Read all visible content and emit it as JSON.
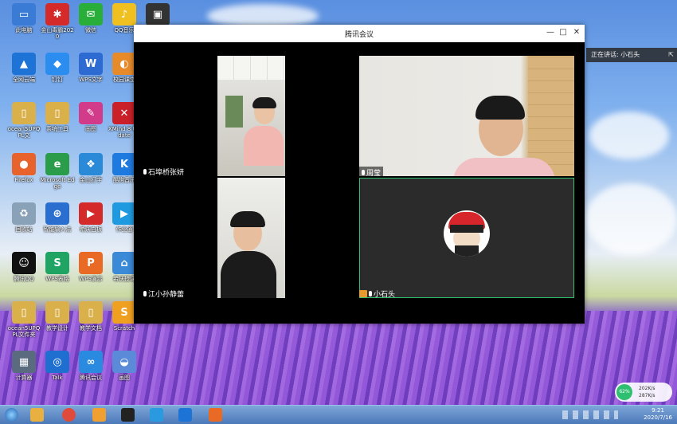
{
  "desktop": {
    "icons": [
      {
        "label": "此电脑",
        "color": "#3a7bd5",
        "glyph": "▭"
      },
      {
        "label": "全网云端",
        "color": "#1d74d6",
        "glyph": "▲"
      },
      {
        "label": "ocean5UPQPL文",
        "color": "#d9b04a",
        "glyph": "▯"
      },
      {
        "label": "Firefox",
        "color": "#e8632b",
        "glyph": "●"
      },
      {
        "label": "回收站",
        "color": "#8aa2b8",
        "glyph": "♻"
      },
      {
        "label": "腾讯QQ",
        "color": "#111111",
        "glyph": "☺"
      },
      {
        "label": "ocean5UPQPL文件夹",
        "color": "#d9b04a",
        "glyph": "▯"
      },
      {
        "label": "计算器",
        "color": "#5a6b80",
        "glyph": "▦"
      },
      {
        "label": "金山毒霸2020",
        "color": "#d42a2a",
        "glyph": "✱"
      },
      {
        "label": "钉钉",
        "color": "#2c8df0",
        "glyph": "◆"
      },
      {
        "label": "系统工具",
        "color": "#d9b04a",
        "glyph": "▯"
      },
      {
        "label": "Microsoft Edge",
        "color": "#2a9c4a",
        "glyph": "e"
      },
      {
        "label": "智能输入法",
        "color": "#2a6fd0",
        "glyph": "⊕"
      },
      {
        "label": "WPS表格",
        "color": "#1fa463",
        "glyph": "S"
      },
      {
        "label": "教学设计",
        "color": "#d9b04a",
        "glyph": "▯"
      },
      {
        "label": "Talk",
        "color": "#1f6fd1",
        "glyph": "◎"
      },
      {
        "label": "微信",
        "color": "#2aae3a",
        "glyph": "✉"
      },
      {
        "label": "WPS文字",
        "color": "#2d6ad2",
        "glyph": "W"
      },
      {
        "label": "画图",
        "color": "#d23a8a",
        "glyph": "✎"
      },
      {
        "label": "金山打字",
        "color": "#2a8ad8",
        "glyph": "❖"
      },
      {
        "label": "希沃白板",
        "color": "#d42a2a",
        "glyph": "▶"
      },
      {
        "label": "WPS演示",
        "color": "#e96a24",
        "glyph": "P"
      },
      {
        "label": "教学文档",
        "color": "#d9b04a",
        "glyph": "▯"
      },
      {
        "label": "腾讯会议",
        "color": "#2a8ae0",
        "glyph": "∞"
      },
      {
        "label": "QQ音乐",
        "color": "#f0c020",
        "glyph": "♪"
      },
      {
        "label": "校园课堂",
        "color": "#e78a2a",
        "glyph": "◐"
      },
      {
        "label": "XMind 8 Update",
        "color": "#c9202a",
        "glyph": "✕"
      },
      {
        "label": "酷狗音乐",
        "color": "#1f7ae0",
        "glyph": "K"
      },
      {
        "label": "作业通",
        "color": "#1f9ae0",
        "glyph": "▶"
      },
      {
        "label": "希沃授课",
        "color": "#3a8ad8",
        "glyph": "⌂"
      },
      {
        "label": "Scratch",
        "color": "#f0a020",
        "glyph": "S"
      },
      {
        "label": "画图",
        "color": "#5a8ad8",
        "glyph": "◒"
      },
      {
        "label": "MAH02",
        "color": "#333333",
        "glyph": "▣"
      }
    ]
  },
  "window": {
    "title": "腾讯会议",
    "controls": {
      "minimize": "—",
      "maximize": "□",
      "close": "✕"
    },
    "participants": [
      {
        "name": "石埠桥张妍"
      },
      {
        "name": "周莹"
      },
      {
        "name": "江小孙静蕾"
      },
      {
        "name": "小石头"
      }
    ]
  },
  "speaking_bar": {
    "text": "正在讲话: 小石头"
  },
  "network": {
    "percent": "62%",
    "up": "202K/s",
    "down": "287K/s"
  },
  "clock": {
    "time": "9:21",
    "date": "2020/7/16"
  },
  "colors": {
    "accent": "#2a8ae0",
    "active_border": "#2fbf71",
    "taskbar": "#4b78b8"
  }
}
